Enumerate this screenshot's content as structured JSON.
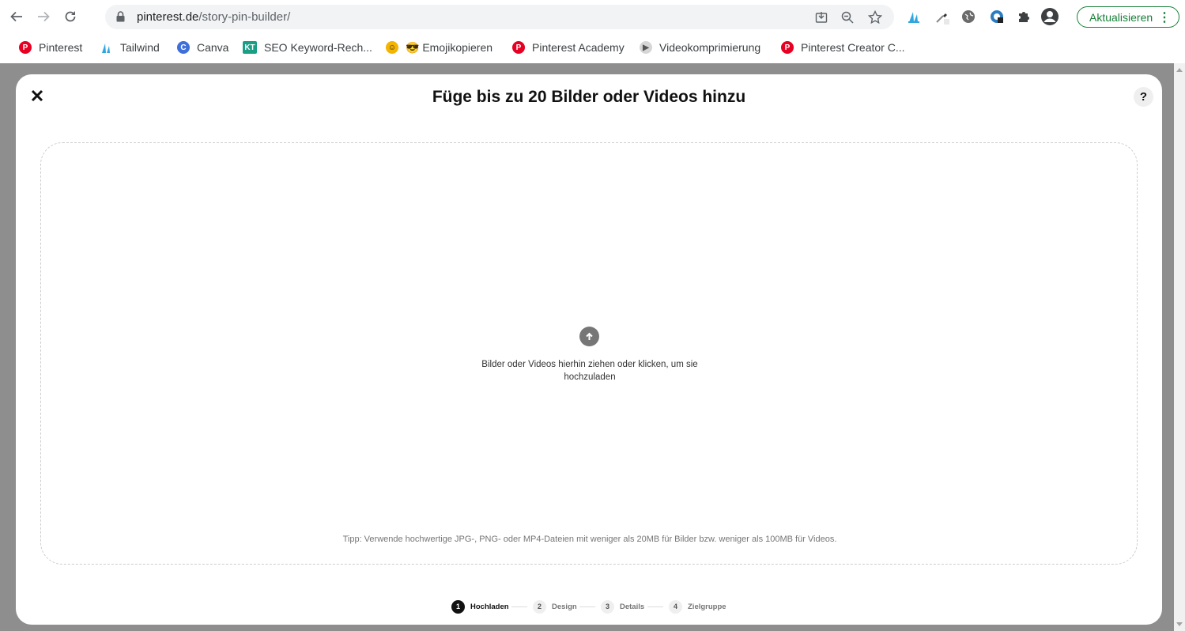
{
  "browser": {
    "url_host": "pinterest.de",
    "url_path": "/story-pin-builder/",
    "update_label": "Aktualisieren"
  },
  "bookmarks": [
    {
      "label": "Pinterest",
      "icon": "pinterest-icon",
      "color": "#e60023"
    },
    {
      "label": "Tailwind",
      "icon": "tailwind-icon",
      "color": "#2fa6de"
    },
    {
      "label": "Canva",
      "icon": "canva-icon",
      "color": "#3f6fd9"
    },
    {
      "label": "SEO Keyword-Rech...",
      "icon": "keyword-tool-icon",
      "color": "#1a9e86"
    },
    {
      "label": "😎 Emojikopieren",
      "icon": "emoji-icon",
      "color": "#f4b400"
    },
    {
      "label": "Pinterest Academy",
      "icon": "pinterest-icon",
      "color": "#e60023"
    },
    {
      "label": "Videokomprimierung",
      "icon": "video-icon",
      "color": "#888888"
    },
    {
      "label": "Pinterest Creator C...",
      "icon": "pinterest-icon",
      "color": "#e60023"
    }
  ],
  "modal": {
    "title": "Füge bis zu 20 Bilder oder Videos hinzu",
    "help_label": "?",
    "drop_text": "Bilder oder Videos hierhin ziehen oder klicken, um sie hochzuladen",
    "tip_text": "Tipp: Verwende hochwertige JPG-, PNG- oder MP4-Dateien mit weniger als 20MB für Bilder bzw. weniger als 100MB für Videos."
  },
  "steps": [
    {
      "num": "1",
      "label": "Hochladen",
      "active": true
    },
    {
      "num": "2",
      "label": "Design",
      "active": false
    },
    {
      "num": "3",
      "label": "Details",
      "active": false
    },
    {
      "num": "4",
      "label": "Zielgruppe",
      "active": false
    }
  ]
}
